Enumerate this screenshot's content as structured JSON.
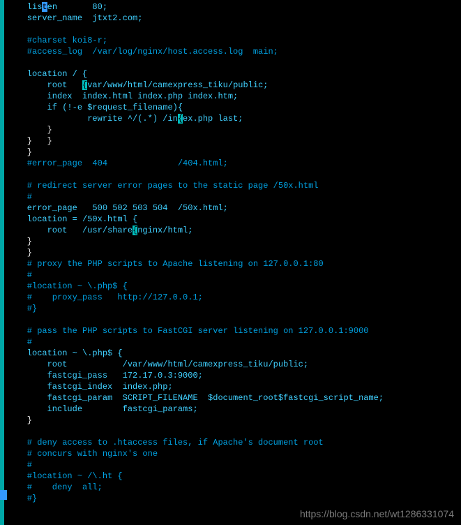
{
  "code": {
    "lines": [
      {
        "indent": "    ",
        "pre": "lis",
        "hl": "t",
        "post": "en       80;",
        "cls": "kw",
        "hlcls": "hl-cursor"
      },
      {
        "indent": "    ",
        "text": "server_name  jtxt2.com;",
        "cls": "kw"
      },
      {
        "indent": "",
        "text": "",
        "cls": "kw"
      },
      {
        "indent": "    ",
        "text": "#charset koi8-r;",
        "cls": "cm"
      },
      {
        "indent": "    ",
        "text": "#access_log  /var/log/nginx/host.access.log  main;",
        "cls": "cm"
      },
      {
        "indent": "",
        "text": "",
        "cls": "kw"
      },
      {
        "indent": "    ",
        "text": "location / {",
        "cls": "kw"
      },
      {
        "indent": "        ",
        "pre": "root   ",
        "hl": "{",
        "post": "var/www/html/camexpress_tiku/public;",
        "cls": "kw",
        "hlcls": "hl-brace"
      },
      {
        "indent": "        ",
        "text": "index  index.html index.php index.htm;",
        "cls": "kw"
      },
      {
        "indent": "        ",
        "text": "if (!-e $request_filename){",
        "cls": "kw"
      },
      {
        "indent": "                ",
        "pre": "rewrite ^/(.*) /in",
        "hl": "{",
        "post": "ex.php last;",
        "cls": "kw",
        "hlcls": "hl-brace"
      },
      {
        "indent": "        ",
        "text": "}",
        "cls": "br"
      },
      {
        "indent": "    ",
        "text": "}   }",
        "cls": "br"
      },
      {
        "indent": "    ",
        "text": "}",
        "cls": "br"
      },
      {
        "indent": "    ",
        "text": "#error_page  404              /404.html;",
        "cls": "cm"
      },
      {
        "indent": "",
        "text": "",
        "cls": "kw"
      },
      {
        "indent": "    ",
        "text": "# redirect server error pages to the static page /50x.html",
        "cls": "cm"
      },
      {
        "indent": "    ",
        "text": "#",
        "cls": "cm"
      },
      {
        "indent": "    ",
        "text": "error_page   500 502 503 504  /50x.html;",
        "cls": "kw"
      },
      {
        "indent": "    ",
        "text": "location = /50x.html {",
        "cls": "kw"
      },
      {
        "indent": "        ",
        "pre": "root   /usr/share",
        "hl": "{",
        "post": "nginx/html;",
        "cls": "kw",
        "hlcls": "hl-brace"
      },
      {
        "indent": "    ",
        "text": "}",
        "cls": "br"
      },
      {
        "indent": "    ",
        "text": "}",
        "cls": "br"
      },
      {
        "indent": "    ",
        "text": "# proxy the PHP scripts to Apache listening on 127.0.0.1:80",
        "cls": "cm"
      },
      {
        "indent": "    ",
        "text": "#",
        "cls": "cm"
      },
      {
        "indent": "    ",
        "text": "#location ~ \\.php$ {",
        "cls": "cm"
      },
      {
        "indent": "    ",
        "text": "#    proxy_pass   http://127.0.0.1;",
        "cls": "cm"
      },
      {
        "indent": "    ",
        "text": "#}",
        "cls": "cm"
      },
      {
        "indent": "",
        "text": "",
        "cls": "kw"
      },
      {
        "indent": "    ",
        "text": "# pass the PHP scripts to FastCGI server listening on 127.0.0.1:9000",
        "cls": "cm"
      },
      {
        "indent": "    ",
        "text": "#",
        "cls": "cm"
      },
      {
        "indent": "    ",
        "text": "location ~ \\.php$ {",
        "cls": "kw"
      },
      {
        "indent": "        ",
        "text": "root           /var/www/html/camexpress_tiku/public;",
        "cls": "kw"
      },
      {
        "indent": "        ",
        "text": "fastcgi_pass   172.17.0.3:9000;",
        "cls": "kw"
      },
      {
        "indent": "        ",
        "text": "fastcgi_index  index.php;",
        "cls": "kw"
      },
      {
        "indent": "        ",
        "text": "fastcgi_param  SCRIPT_FILENAME  $document_root$fastcgi_script_name;",
        "cls": "kw"
      },
      {
        "indent": "        ",
        "text": "include        fastcgi_params;",
        "cls": "kw"
      },
      {
        "indent": "    ",
        "text": "}",
        "cls": "br"
      },
      {
        "indent": "",
        "text": "",
        "cls": "kw"
      },
      {
        "indent": "    ",
        "text": "# deny access to .htaccess files, if Apache's document root",
        "cls": "cm"
      },
      {
        "indent": "    ",
        "text": "# concurs with nginx's one",
        "cls": "cm"
      },
      {
        "indent": "    ",
        "text": "#",
        "cls": "cm"
      },
      {
        "indent": "    ",
        "text": "#location ~ /\\.ht {",
        "cls": "cm"
      },
      {
        "indent": "    ",
        "text": "#    deny  all;",
        "cls": "cm"
      },
      {
        "indent": "    ",
        "text": "#}",
        "cls": "cm"
      }
    ]
  },
  "watermark": "https://blog.csdn.net/wt1286331074"
}
